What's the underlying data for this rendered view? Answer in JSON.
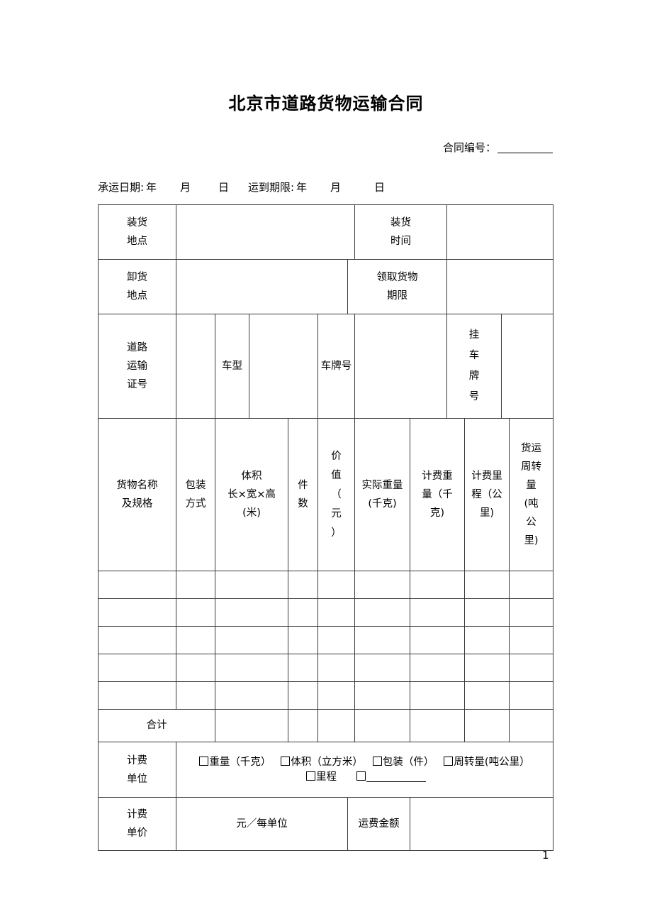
{
  "document": {
    "title": "北京市道路货物运输合同",
    "contract_no_label": "合同编号：",
    "page_number": "1"
  },
  "date_line": {
    "carry_date_label": "承运日期:",
    "year": "年",
    "month": "月",
    "day": "日",
    "arrive_deadline_label": "运到期限:",
    "year2": "年",
    "month2": "月",
    "day2": "日"
  },
  "table": {
    "row_load": {
      "label": "装货\n地点",
      "label_line1": "装货",
      "label_line2": "地点",
      "value": "",
      "time_label_line1": "装货",
      "time_label_line2": "时间",
      "time_value": ""
    },
    "row_unload": {
      "label_line1": "卸货",
      "label_line2": "地点",
      "value": "",
      "pickup_label_line1": "领取货物",
      "pickup_label_line2": "期限",
      "pickup_value": ""
    },
    "row_vehicle": {
      "permit_label_line1": "道路",
      "permit_label_line2": "运输",
      "permit_label_line3": "证号",
      "permit_value": "",
      "model_label": "车型",
      "model_value": "",
      "plate_label": "车牌号",
      "plate_value": "",
      "trailer_label_c1": "挂",
      "trailer_label_c2": "车",
      "trailer_label_c3": "牌",
      "trailer_label_c4": "号",
      "trailer_value": ""
    },
    "goods_headers": {
      "name": {
        "line1": "货物名称",
        "line2": "及规格"
      },
      "packing": {
        "line1": "包装",
        "line2": "方式"
      },
      "volume": {
        "line1": "体积",
        "line2": "长×宽×高",
        "line3": "(米)"
      },
      "pieces": {
        "line1": "件",
        "line2": "数"
      },
      "value": {
        "c1": "价",
        "c2": "值",
        "c3": "（",
        "c4": "元",
        "c5": "）"
      },
      "actual_weight": {
        "line1": "实际重量",
        "line2": "(千克)"
      },
      "charge_weight": {
        "line1": "计费重",
        "line2": "量（千",
        "line3": "克)"
      },
      "charge_distance": {
        "line1": "计费里",
        "line2": "程（公",
        "line3": "里)"
      },
      "turnover": {
        "line1": "货运",
        "line2": "周转",
        "line3": "量",
        "line4": "(吨",
        "line5": "公",
        "line6": "里)"
      }
    },
    "goods_rows": [
      {
        "name": "",
        "packing": "",
        "volume": "",
        "pieces": "",
        "value": "",
        "actual_weight": "",
        "charge_weight": "",
        "charge_distance": "",
        "turnover": ""
      },
      {
        "name": "",
        "packing": "",
        "volume": "",
        "pieces": "",
        "value": "",
        "actual_weight": "",
        "charge_weight": "",
        "charge_distance": "",
        "turnover": ""
      },
      {
        "name": "",
        "packing": "",
        "volume": "",
        "pieces": "",
        "value": "",
        "actual_weight": "",
        "charge_weight": "",
        "charge_distance": "",
        "turnover": ""
      },
      {
        "name": "",
        "packing": "",
        "volume": "",
        "pieces": "",
        "value": "",
        "actual_weight": "",
        "charge_weight": "",
        "charge_distance": "",
        "turnover": ""
      },
      {
        "name": "",
        "packing": "",
        "volume": "",
        "pieces": "",
        "value": "",
        "actual_weight": "",
        "charge_weight": "",
        "charge_distance": "",
        "turnover": ""
      }
    ],
    "total_row": {
      "label": "合计",
      "volume": "",
      "pieces": "",
      "value": "",
      "actual_weight": "",
      "charge_weight": "",
      "charge_distance": "",
      "turnover": ""
    },
    "charge_unit_row": {
      "label_line1": "计费",
      "label_line2": "单位",
      "options": [
        {
          "text": "重量（千克）",
          "checked": false
        },
        {
          "text": "体积（立方米）",
          "checked": false
        },
        {
          "text": "包装（件）",
          "checked": false
        },
        {
          "text": "周转量（吨公里）",
          "checked": false
        },
        {
          "text": "里程",
          "checked": false
        },
        {
          "text": "",
          "checked": false
        }
      ],
      "opt1": "重量（千克）",
      "opt2": "体积（立方米）",
      "opt3": "包装（件）",
      "opt4a": "周转量",
      "opt4b": "(吨公里）",
      "opt5": "里程",
      "opt6": ""
    },
    "charge_price_row": {
      "label_line1": "计费",
      "label_line2": "单价",
      "per_unit": "元／每单位",
      "freight_amount_label": "运费金额",
      "freight_amount_value": ""
    }
  }
}
